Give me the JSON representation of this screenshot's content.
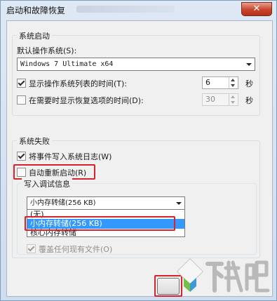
{
  "window": {
    "title": "启动和故障恢复",
    "close_glyph": "✕"
  },
  "system_startup": {
    "group_title": "系统启动",
    "default_os_label": "默认操作系统(S):",
    "default_os_value": "Windows 7 Ultimate x64",
    "show_os_list": {
      "label": "显示操作系统列表的时间(T):",
      "checked": true,
      "value": "6",
      "unit": "秒"
    },
    "show_recovery": {
      "label": "在需要时显示恢复选项的时间(D):",
      "checked": false,
      "value": "30",
      "unit": "秒"
    }
  },
  "system_failure": {
    "group_title": "系统失败",
    "write_event_log": {
      "label": "将事件写入系统日志(W)",
      "checked": true
    },
    "auto_restart": {
      "label": "自动重新启动(R)",
      "checked": false
    },
    "debug_group_title": "写入调试信息",
    "debug_select_value": "小内存转储(256 KB)",
    "debug_options": [
      "(无)",
      "小内存转储(256 KB)",
      "核心内存转储"
    ],
    "overwrite": {
      "label": "覆盖任何现有文件(O)",
      "checked": true
    }
  },
  "watermark": {
    "text": "下载吧"
  },
  "colors": {
    "annotation_red": "#d6232e",
    "selection_blue": "#3399ff"
  }
}
